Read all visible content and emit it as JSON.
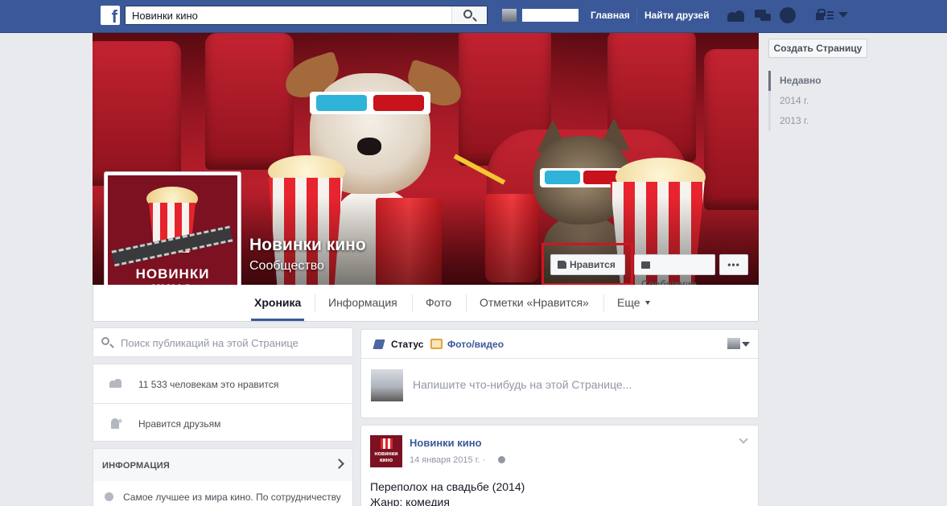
{
  "topbar": {
    "logo_letter": "f",
    "search_value": "Новинки кино",
    "nav_home": "Главная",
    "nav_find_friends": "Найти друзей"
  },
  "cover": {
    "page_name": "Новинки кино",
    "page_category": "Сообщество",
    "like_button": "Нравится",
    "message_button": "Сообщение",
    "more_button": "•••"
  },
  "profile_picture": {
    "line1": "НОВИНКИ",
    "line2": "КИНО"
  },
  "tabs": [
    {
      "label": "Хроника",
      "active": true
    },
    {
      "label": "Информация",
      "active": false
    },
    {
      "label": "Фото",
      "active": false
    },
    {
      "label": "Отметки «Нравится»",
      "active": false
    },
    {
      "label": "Еще",
      "active": false
    }
  ],
  "right_column": {
    "create_page_button": "Создать Страницу",
    "years": [
      "Недавно",
      "2014 г.",
      "2013 г."
    ]
  },
  "left_column": {
    "search_placeholder": "Поиск публикаций на этой Странице",
    "likes_count_text": "11 533 человекам это нравится",
    "friends_like_text": "Нравится друзьям",
    "info_header": "ИНФОРМАЦИЯ",
    "info_text": "Самое лучшее из мира кино. По сотрудничеству"
  },
  "composer": {
    "tab_status": "Статус",
    "tab_photo_video": "Фото/видео",
    "placeholder": "Напишите что-нибудь на этой Странице..."
  },
  "post": {
    "author": "Новинки кино",
    "avatar_text": "новинки кино",
    "date": "14 января 2015 г. ·",
    "line1": "Переполох на свадьбе (2014)",
    "line2": "Жанр: комедия"
  },
  "colors": {
    "brand_blue": "#3b5998",
    "highlight_red": "#d3141e",
    "profile_bg": "#7b1121"
  }
}
